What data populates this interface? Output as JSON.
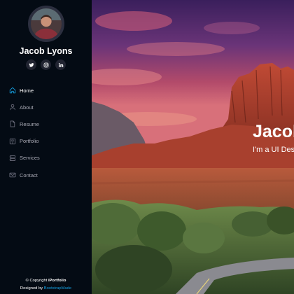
{
  "profile": {
    "name": "Jacob Lyons"
  },
  "socials": [
    {
      "icon": "twitter-icon"
    },
    {
      "icon": "instagram-icon"
    },
    {
      "icon": "linkedin-icon"
    }
  ],
  "nav": {
    "items": [
      {
        "label": "Home",
        "icon": "home-icon",
        "active": true
      },
      {
        "label": "About",
        "icon": "person-icon",
        "active": false
      },
      {
        "label": "Resume",
        "icon": "file-icon",
        "active": false
      },
      {
        "label": "Portfolio",
        "icon": "book-icon",
        "active": false
      },
      {
        "label": "Services",
        "icon": "server-icon",
        "active": false
      },
      {
        "label": "Contact",
        "icon": "envelope-icon",
        "active": false
      }
    ]
  },
  "footer": {
    "copyright_prefix": "© Copyright",
    "brand": "iPortfolio",
    "designed_by_prefix": "Designed by",
    "designer": "BootstrapMade"
  },
  "hero": {
    "title": "Jacob Lyons",
    "subtitle": "I'm a UI Designer"
  },
  "colors": {
    "sidebar_bg": "#040b14",
    "accent": "#149ddd",
    "nav_text": "#a8a9b4"
  }
}
